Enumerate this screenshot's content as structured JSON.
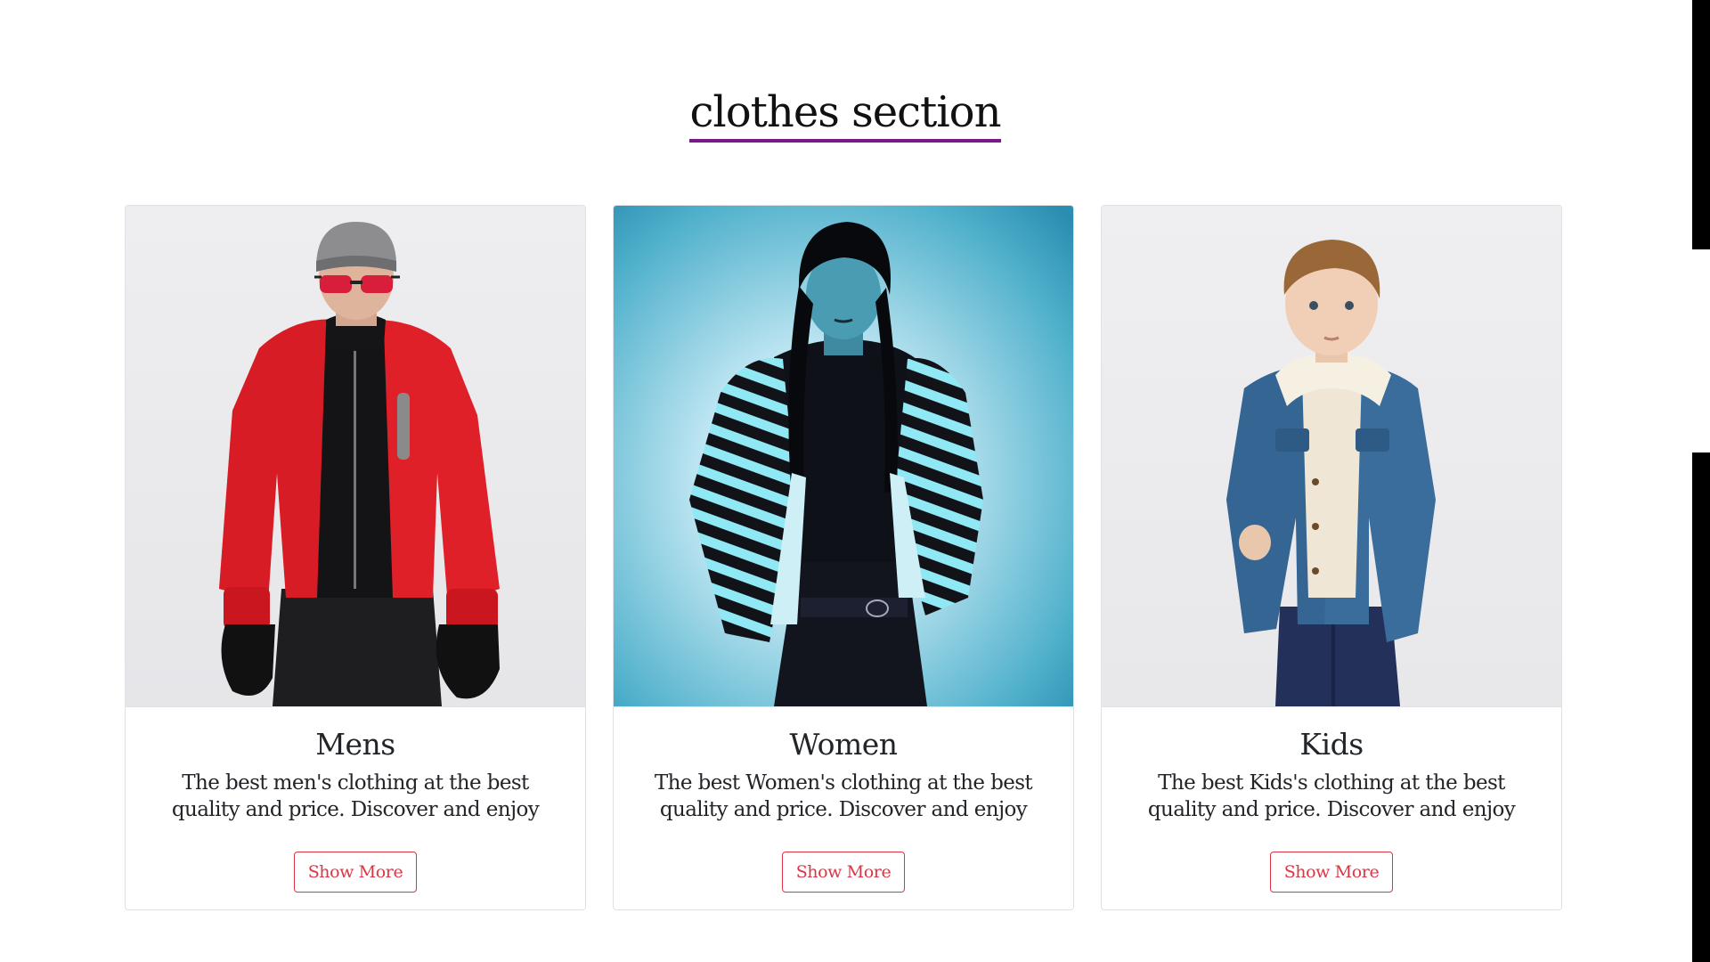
{
  "section": {
    "title": "clothes section",
    "underline_color": "#7a1a8a"
  },
  "cards": [
    {
      "image_icon": "mens-jacket-photo",
      "title": "Mens",
      "text": "The best men's clothing at the best quality and price. Discover and enjoy",
      "button_label": "Show More"
    },
    {
      "image_icon": "womens-fashion-photo",
      "title": "Women",
      "text": "The best Women's clothing at the best quality and price. Discover and enjoy",
      "button_label": "Show More"
    },
    {
      "image_icon": "kids-jacket-photo",
      "title": "Kids",
      "text": "The best Kids's clothing at the best quality and price. Discover and enjoy",
      "button_label": "Show More"
    }
  ],
  "colors": {
    "button_accent": "#dc3545",
    "card_border": "#dee2e6"
  }
}
